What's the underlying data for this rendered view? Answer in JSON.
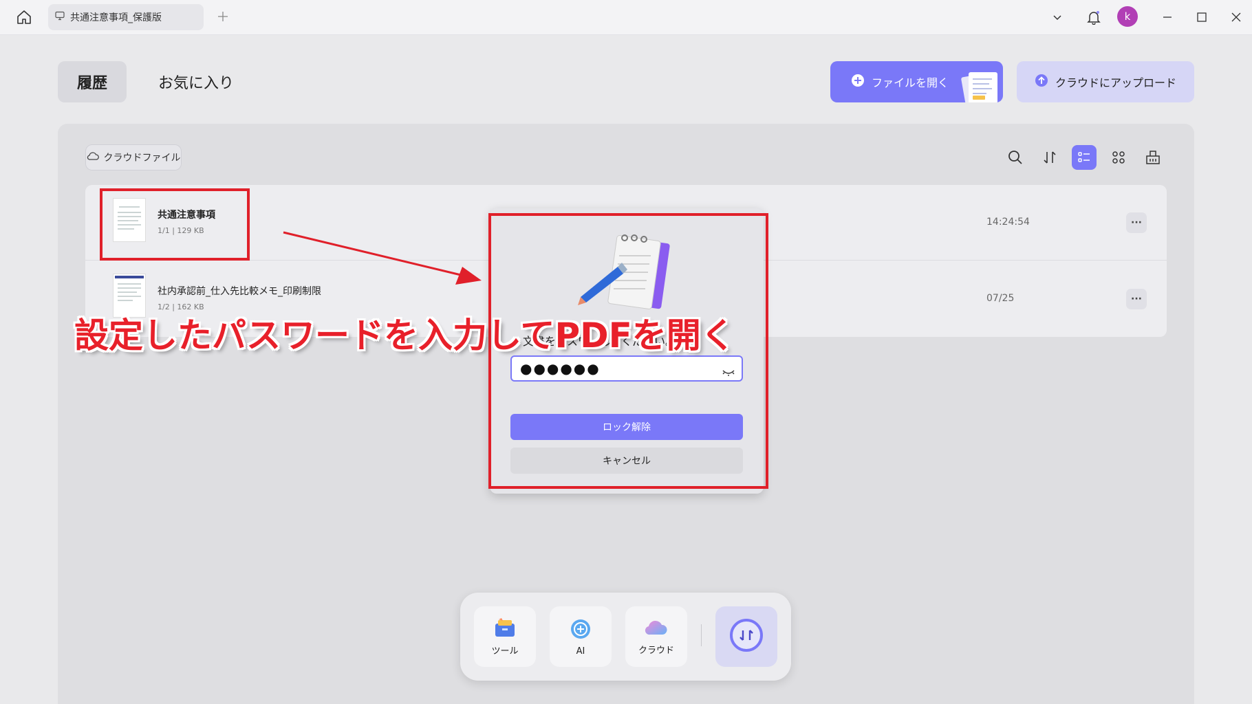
{
  "titlebar": {
    "tab_title": "共通注意事項_保護版",
    "avatar_letter": "k"
  },
  "nav": {
    "history": "履歴",
    "favorites": "お気に入り",
    "open_file": "ファイルを開く",
    "upload_cloud": "クラウドにアップロード"
  },
  "toolbar": {
    "cloud_files": "クラウドファイル"
  },
  "files": [
    {
      "name": "共通注意事項",
      "meta": "1/1 | 129 KB",
      "date": "14:24:54"
    },
    {
      "name": "社内承認前_仕入先比較メモ_印刷制限",
      "meta": "1/2 | 162 KB",
      "date": "07/25"
    }
  ],
  "dialog": {
    "prompt": "文書を…スワ…してください。",
    "password_value": "●●●●●●",
    "unlock": "ロック解除",
    "cancel": "キャンセル"
  },
  "annotation": {
    "text": "設定したパスワードを入力してPDFを開く"
  },
  "dock": {
    "tools": "ツール",
    "ai": "AI",
    "cloud": "クラウド"
  },
  "colors": {
    "accent": "#7a78f8",
    "annotation_red": "#e0202a"
  }
}
